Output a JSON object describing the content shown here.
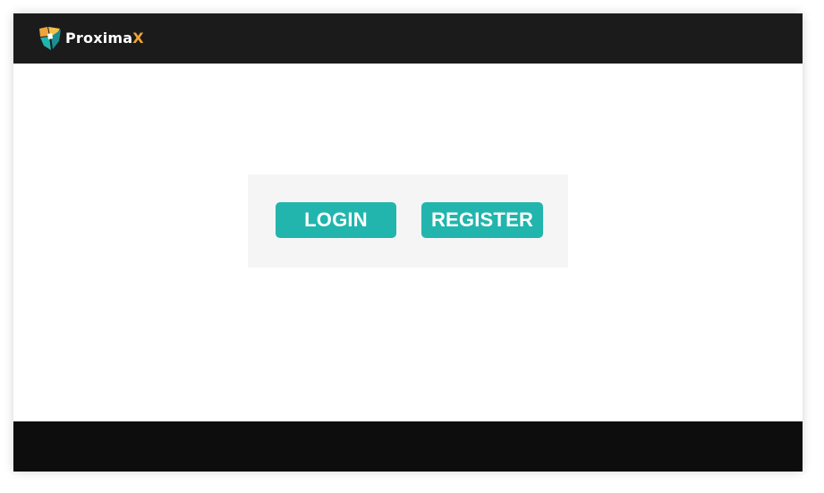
{
  "header": {
    "brand_name_main": "Proxima",
    "brand_name_accent": "X",
    "logo_icon": "proximax-logo-icon",
    "brand_accent_color": "#f1a43a",
    "brand_teal_color": "#21b5ad"
  },
  "auth": {
    "login_label": "LOGIN",
    "register_label": "REGISTER",
    "button_color": "#21b5ad"
  }
}
